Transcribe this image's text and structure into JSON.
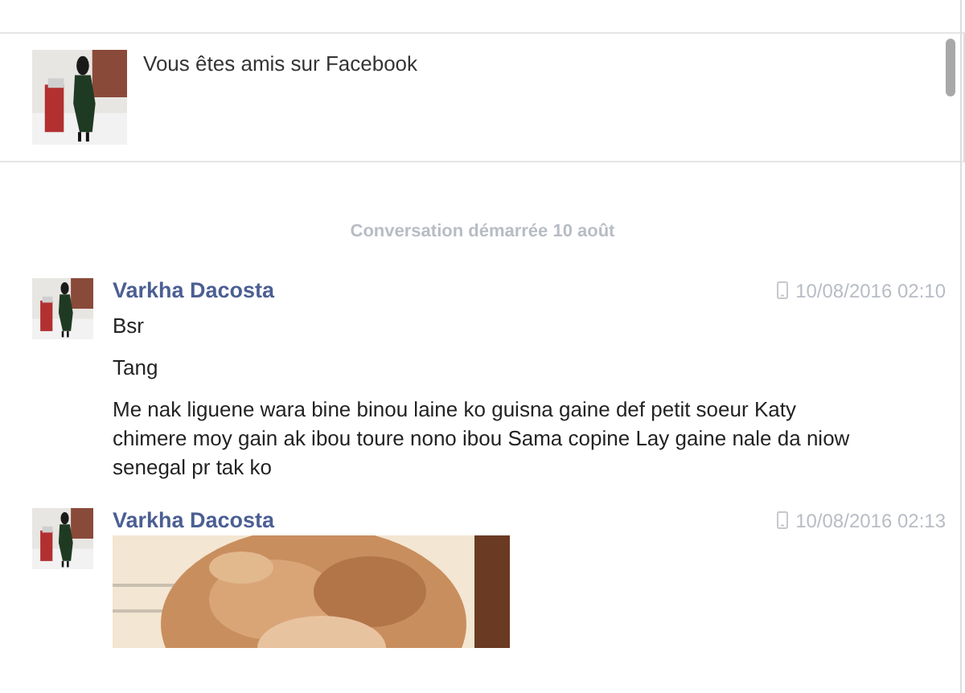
{
  "friendship": {
    "text": "Vous êtes amis sur Facebook"
  },
  "conversation_start": "Conversation démarrée 10 août",
  "messages": [
    {
      "sender": "Varkha Dacosta",
      "time": "10/08/2016 02:10",
      "kind": "text",
      "paragraphs": [
        "Bsr",
        "Tang",
        "Me nak liguene wara bine binou laine ko guisna gaine def petit soeur Katy chimere moy gain ak ibou toure nono ibou Sama copine Lay gaine nale da niow senegal pr tak ko"
      ]
    },
    {
      "sender": "Varkha Dacosta",
      "time": "10/08/2016 02:13"
    }
  ]
}
